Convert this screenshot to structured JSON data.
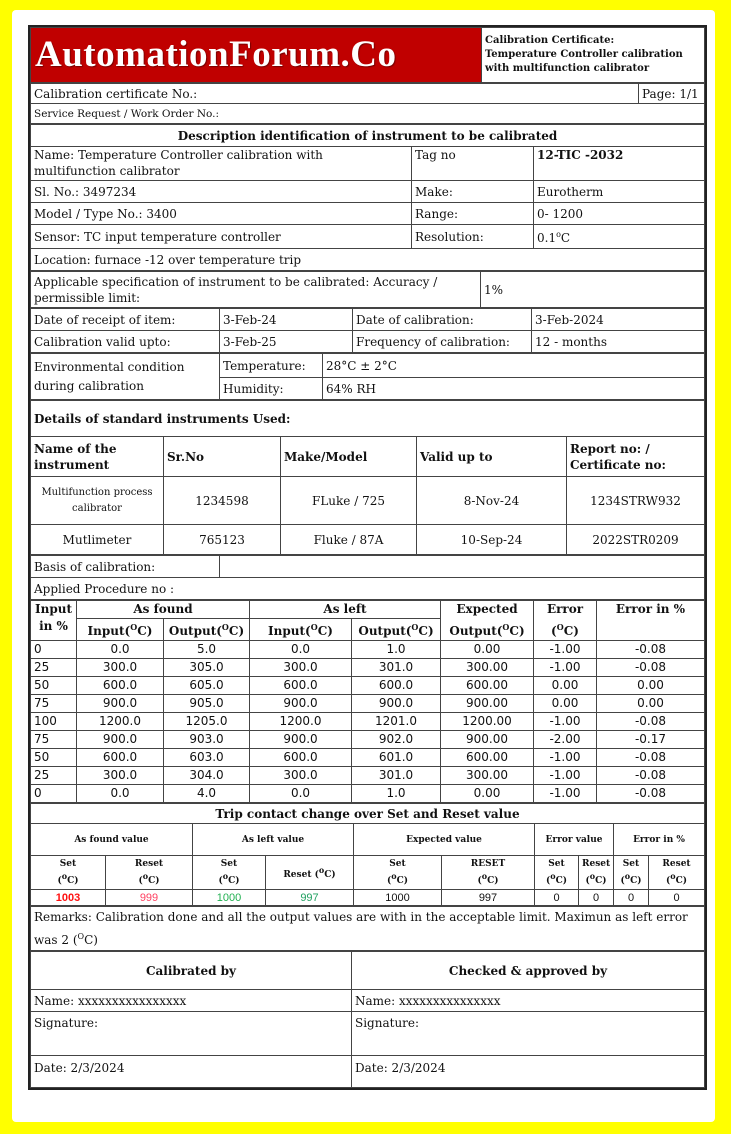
{
  "header": {
    "brand": "AutomationForum.Co",
    "title_lines": [
      "Calibration Certificate:",
      "Temperature Controller calibration",
      "with multifunction calibrator"
    ]
  },
  "meta": {
    "cert_no_label": "Calibration certificate No.:",
    "page": "Page: 1/1",
    "service_request_label": "Service Request / Work  Order No.:"
  },
  "instrument": {
    "section_title": "Description identification of instrument to be calibrated",
    "name": "Name: Temperature Controller calibration with multifunction calibrator",
    "tag_label": "Tag no",
    "tag_value": "12-TIC -2032",
    "sl_no": "Sl. No.: 3497234",
    "make_label": "Make:",
    "make_value": "Eurotherm",
    "model": "Model / Type No.: 3400",
    "range_label": "Range:",
    "range_value": "0- 1200",
    "sensor": "Sensor: TC input temperature controller",
    "resolution_label": "Resolution:",
    "resolution_value": "0.1",
    "resolution_unit": "C",
    "location": "Location: furnace -12 over temperature trip",
    "spec_label": "Applicable specification of instrument to be calibrated: Accuracy / permissible limit:",
    "spec_value": "1%",
    "receipt_label": "Date of receipt of item:",
    "receipt_value": "3-Feb-24",
    "cal_date_label": "Date of calibration:",
    "cal_date_value": "3-Feb-2024",
    "valid_label": "Calibration valid upto:",
    "valid_value": "3-Feb-25",
    "freq_label": "Frequency of calibration:",
    "freq_value": "12 - months",
    "env_label": "Environmental condition during calibration",
    "temp_label": "Temperature:",
    "temp_value": "28°C ± 2°C",
    "hum_label": "Humidity:",
    "hum_value": "64% RH"
  },
  "standards": {
    "title": "Details of standard instruments Used:",
    "headers": [
      "Name of the instrument",
      "Sr.No",
      "Make/Model",
      "Valid up to",
      "Report no: / Certificate no:"
    ],
    "rows": [
      [
        "Multifunction process calibrator",
        "1234598",
        "FLuke / 725",
        "8-Nov-24",
        "1234STRW932"
      ],
      [
        "Mutlimeter",
        "765123",
        "Fluke / 87A",
        "10-Sep-24",
        "2022STR0209"
      ]
    ]
  },
  "basis_label": "Basis of calibration:",
  "procedure_label": "Applied Procedure no  :",
  "readings": {
    "headers": {
      "input_pct": "Input in %",
      "as_found": "As found",
      "as_left": "As left",
      "input": "Input(",
      "output": "Output(",
      "unit": "C)",
      "expected": "Expected",
      "expected_output": "Output(",
      "error": "Error",
      "error_unit": "(",
      "error_pct": "Error in %"
    },
    "rows": [
      [
        "0",
        "0.0",
        "5.0",
        "0.0",
        "1.0",
        "0.00",
        "-1.00",
        "-0.08"
      ],
      [
        "25",
        "300.0",
        "305.0",
        "300.0",
        "301.0",
        "300.00",
        "-1.00",
        "-0.08"
      ],
      [
        "50",
        "600.0",
        "605.0",
        "600.0",
        "600.0",
        "600.00",
        "0.00",
        "0.00"
      ],
      [
        "75",
        "900.0",
        "905.0",
        "900.0",
        "900.0",
        "900.00",
        "0.00",
        "0.00"
      ],
      [
        "100",
        "1200.0",
        "1205.0",
        "1200.0",
        "1201.0",
        "1200.00",
        "-1.00",
        "-0.08"
      ],
      [
        "75",
        "900.0",
        "903.0",
        "900.0",
        "902.0",
        "900.00",
        "-2.00",
        "-0.17"
      ],
      [
        "50",
        "600.0",
        "603.0",
        "600.0",
        "601.0",
        "600.00",
        "-1.00",
        "-0.08"
      ],
      [
        "25",
        "300.0",
        "304.0",
        "300.0",
        "301.0",
        "300.00",
        "-1.00",
        "-0.08"
      ],
      [
        "0",
        "0.0",
        "4.0",
        "0.0",
        "1.0",
        "0.00",
        "-1.00",
        "-0.08"
      ]
    ]
  },
  "trip": {
    "title": "Trip contact change over Set and Reset value",
    "groups": [
      "As found value",
      "As left value",
      "Expected value",
      "Error value",
      "Error in %"
    ],
    "subheaders": [
      "Set",
      "Reset",
      "Set",
      "Reset",
      "Set",
      "RESET",
      "Set",
      "Reset",
      "Set",
      "Reset"
    ],
    "values": [
      "1003",
      "999",
      "1000",
      "997",
      "1000",
      "997",
      "0",
      "0",
      "0",
      "0"
    ],
    "colors": {
      "found_set": "#ff1010",
      "found_reset": "#ff4060",
      "left_set": "#20b050",
      "left_reset": "#20a060"
    }
  },
  "remarks": "Remarks: Calibration done and all the output values are with in the acceptable limit. Maximun as left error was 2 (",
  "remarks_tail": "C)",
  "signoff": {
    "calibrated_by": "Calibrated by",
    "approved_by": "Checked & approved by",
    "name_left": "Name:   xxxxxxxxxxxxxxxx",
    "name_right": "Name: xxxxxxxxxxxxxxx",
    "signature": "Signature:",
    "date_left": "Date: 2/3/2024",
    "date_right": "Date:  2/3/2024"
  }
}
